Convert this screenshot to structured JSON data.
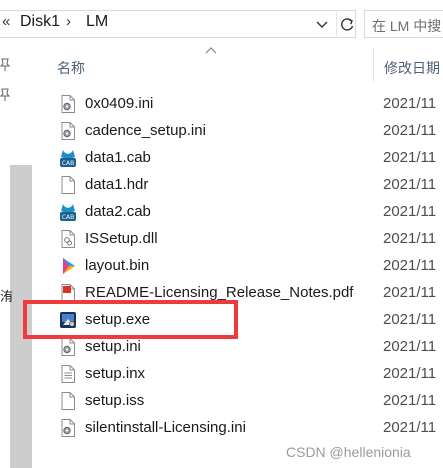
{
  "address_bar": {
    "back_glyph": "«",
    "path": [
      "Disk1",
      "LM"
    ],
    "separator": "›",
    "dropdown_icon": "chevron-down-icon",
    "refresh_icon": "refresh-icon"
  },
  "search": {
    "placeholder": "在 LM 中搜"
  },
  "columns": {
    "name": "名称",
    "date": "修改日期"
  },
  "nav": {
    "glyph": "洧"
  },
  "files": [
    {
      "name": "0x0409.ini",
      "date": "2021/11",
      "icon": "settings-file-icon"
    },
    {
      "name": "cadence_setup.ini",
      "date": "2021/11",
      "icon": "settings-file-icon"
    },
    {
      "name": "data1.cab",
      "date": "2021/11",
      "icon": "cab-archive-icon"
    },
    {
      "name": "data1.hdr",
      "date": "2021/11",
      "icon": "blank-file-icon"
    },
    {
      "name": "data2.cab",
      "date": "2021/11",
      "icon": "cab-archive-icon"
    },
    {
      "name": "ISSetup.dll",
      "date": "2021/11",
      "icon": "dll-file-icon"
    },
    {
      "name": "layout.bin",
      "date": "2021/11",
      "icon": "media-file-icon"
    },
    {
      "name": "README-Licensing_Release_Notes.pdf",
      "date": "2021/11",
      "icon": "pdf-file-icon"
    },
    {
      "name": "setup.exe",
      "date": "2021/11",
      "icon": "installer-exe-icon"
    },
    {
      "name": "setup.ini",
      "date": "2021/11",
      "icon": "settings-file-icon"
    },
    {
      "name": "setup.inx",
      "date": "2021/11",
      "icon": "text-file-icon"
    },
    {
      "name": "setup.iss",
      "date": "2021/11",
      "icon": "blank-file-icon"
    },
    {
      "name": "silentinstall-Licensing.ini",
      "date": "2021/11",
      "icon": "settings-file-icon"
    }
  ],
  "watermark": "CSDN @hellenionia",
  "colors": {
    "highlight": "#ef3b3b",
    "header_text": "#4c607a",
    "cab_badge": "#1f8fc9"
  }
}
